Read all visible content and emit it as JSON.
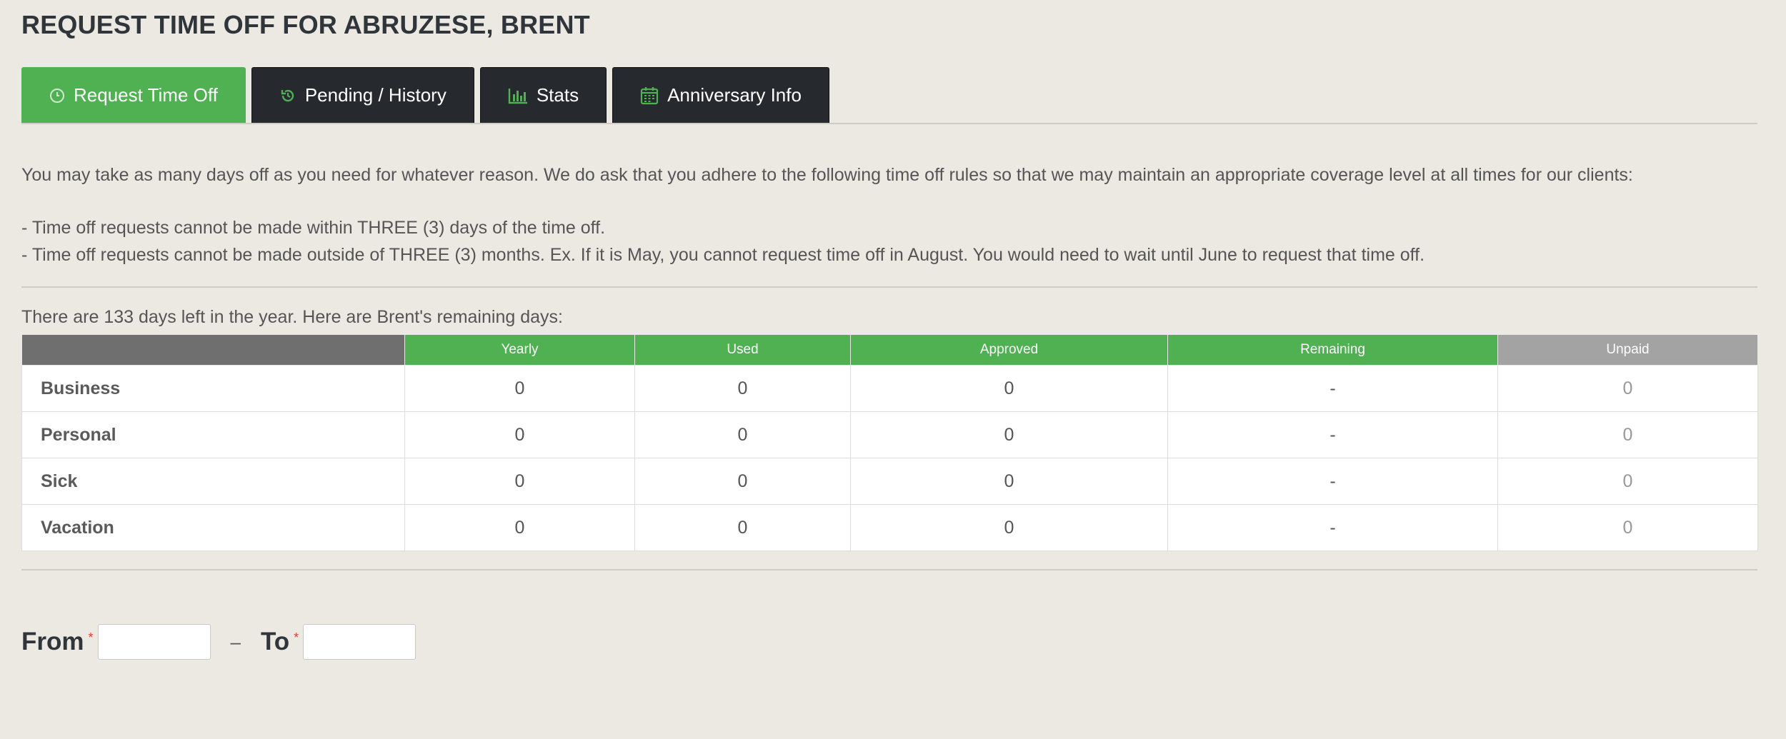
{
  "page": {
    "title": "REQUEST TIME OFF FOR ABRUZESE, BRENT"
  },
  "tabs": [
    {
      "label": "Request Time Off",
      "icon": "clock-icon",
      "active": true
    },
    {
      "label": "Pending / History",
      "icon": "history-icon",
      "active": false
    },
    {
      "label": "Stats",
      "icon": "bar-chart-icon",
      "active": false
    },
    {
      "label": "Anniversary Info",
      "icon": "calendar-icon",
      "active": false
    }
  ],
  "intro": {
    "text": "You may take as many days off as you need for whatever reason. We do ask that you adhere to the following time off rules so that we may maintain an appropriate coverage level at all times for our clients:",
    "rules": [
      "- Time off requests cannot be made within THREE (3) days of the time off.",
      "- Time off requests cannot be made outside of THREE (3) months. Ex. If it is May, you cannot request time off in August. You would need to wait until June to request that time off."
    ]
  },
  "balances": {
    "summary": "There are 133 days left in the year. Here are Brent's remaining days:",
    "columns": [
      "",
      "Yearly",
      "Used",
      "Approved",
      "Remaining",
      "Unpaid"
    ],
    "rows": [
      {
        "type": "Business",
        "yearly": "0",
        "used": "0",
        "approved": "0",
        "remaining": "-",
        "unpaid": "0"
      },
      {
        "type": "Personal",
        "yearly": "0",
        "used": "0",
        "approved": "0",
        "remaining": "-",
        "unpaid": "0"
      },
      {
        "type": "Sick",
        "yearly": "0",
        "used": "0",
        "approved": "0",
        "remaining": "-",
        "unpaid": "0"
      },
      {
        "type": "Vacation",
        "yearly": "0",
        "used": "0",
        "approved": "0",
        "remaining": "-",
        "unpaid": "0"
      }
    ]
  },
  "dates": {
    "from_label": "From",
    "to_label": "To",
    "required_mark": "*",
    "separator": "–",
    "from_value": "",
    "to_value": ""
  },
  "colors": {
    "accent": "#50b153",
    "tab_dark": "#262a2e",
    "header_blank": "#6f6f6f",
    "header_unpaid": "#a3a3a3",
    "required": "#e03c31",
    "background": "#ece9e2"
  }
}
